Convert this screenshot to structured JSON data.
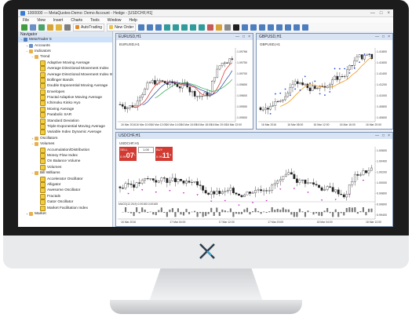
{
  "window": {
    "title": "1000000 — MetaQuotes-Demo: Demo Account - Hedge - [USDCHF,H1]",
    "controls": [
      "—",
      "□",
      "×"
    ]
  },
  "menu": [
    "File",
    "View",
    "Insert",
    "Charts",
    "Tools",
    "Window",
    "Help"
  ],
  "toolbar": {
    "autotrading_label": "AutoTrading",
    "new_order_label": "New Order"
  },
  "navigator": {
    "title": "Navigator",
    "items": [
      {
        "label": "MetaTrader 5",
        "level": 0,
        "icon": "terminal-icon",
        "expanded": true
      },
      {
        "label": "Accounts",
        "level": 1,
        "icon": "accounts-icon",
        "expanded": false
      },
      {
        "label": "Indicators",
        "level": 1,
        "icon": "folder-icon",
        "expanded": true
      },
      {
        "label": "Trend",
        "level": 2,
        "icon": "folder-icon",
        "expanded": true
      },
      {
        "label": "Adaptive Moving Average",
        "level": 3,
        "icon": "indicator-icon"
      },
      {
        "label": "Average Directional Movement Index",
        "level": 3,
        "icon": "indicator-icon"
      },
      {
        "label": "Average Directional Movement Index Wilder",
        "level": 3,
        "icon": "indicator-icon"
      },
      {
        "label": "Bollinger Bands",
        "level": 3,
        "icon": "indicator-icon"
      },
      {
        "label": "Double Exponential Moving Average",
        "level": 3,
        "icon": "indicator-icon"
      },
      {
        "label": "Envelopes",
        "level": 3,
        "icon": "indicator-icon"
      },
      {
        "label": "Fractal Adaptive Moving Average",
        "level": 3,
        "icon": "indicator-icon"
      },
      {
        "label": "Ichimoku Kinko Hyo",
        "level": 3,
        "icon": "indicator-icon"
      },
      {
        "label": "Moving Average",
        "level": 3,
        "icon": "indicator-icon"
      },
      {
        "label": "Parabolic SAR",
        "level": 3,
        "icon": "indicator-icon"
      },
      {
        "label": "Standard Deviation",
        "level": 3,
        "icon": "indicator-icon"
      },
      {
        "label": "Triple Exponential Moving Average",
        "level": 3,
        "icon": "indicator-icon"
      },
      {
        "label": "Variable Index Dynamic Average",
        "level": 3,
        "icon": "indicator-icon"
      },
      {
        "label": "Oscillators",
        "level": 2,
        "icon": "folder-icon",
        "expanded": false
      },
      {
        "label": "Volumes",
        "level": 2,
        "icon": "folder-icon",
        "expanded": true
      },
      {
        "label": "Accumulation/Distribution",
        "level": 3,
        "icon": "indicator-icon"
      },
      {
        "label": "Money Flow Index",
        "level": 3,
        "icon": "indicator-icon"
      },
      {
        "label": "On Balance Volume",
        "level": 3,
        "icon": "indicator-icon"
      },
      {
        "label": "Volumes",
        "level": 3,
        "icon": "indicator-icon"
      },
      {
        "label": "Bill Williams",
        "level": 2,
        "icon": "folder-icon",
        "expanded": true
      },
      {
        "label": "Accelerator Oscillator",
        "level": 3,
        "icon": "indicator-icon"
      },
      {
        "label": "Alligator",
        "level": 3,
        "icon": "indicator-icon"
      },
      {
        "label": "Awesome Oscillator",
        "level": 3,
        "icon": "indicator-icon"
      },
      {
        "label": "Fractals",
        "level": 3,
        "icon": "indicator-icon"
      },
      {
        "label": "Gator Oscillator",
        "level": 3,
        "icon": "indicator-icon"
      },
      {
        "label": "Market Facilitation Index",
        "level": 3,
        "icon": "indicator-icon"
      },
      {
        "label": "Market",
        "level": 1,
        "icon": "folder-icon",
        "expanded": false
      }
    ]
  },
  "charts": {
    "eurusd": {
      "window_title": "EURUSD,H1",
      "symbol_label": "EURUSD,H1",
      "prices": [
        "1.09766",
        "1.09750",
        "1.09700",
        "1.09650",
        "1.09600",
        "1.09550",
        "1.09500"
      ],
      "times": [
        "16 Mar 2016",
        "16 Mar 10:00",
        "16 Mar 12:00",
        "16 Mar 14:00",
        "16 Mar 16:00",
        "16 Mar 18:00",
        "16 Mar 20:00",
        "16 Mar 22:00"
      ]
    },
    "gbpusd": {
      "window_title": "GBPUSD,H1",
      "symbol_label": "GBPUSD,H1",
      "prices": [
        "1.41800",
        "1.41600",
        "1.41400",
        "1.41200",
        "1.41000",
        "1.40800",
        "1.40600"
      ],
      "times": [
        "16 Mar 2016",
        "16 Mar 08:00",
        "16 Mar 12:00",
        "16 Mar 16:00",
        "16 Mar 20:00"
      ]
    },
    "usdchf": {
      "window_title": "USDCHF,H1",
      "symbol_label": "USDCHF,H1",
      "oneclick": {
        "sell_label": "SELL",
        "buy_label": "BUY",
        "lot": "1.00",
        "sell_small": "0.99",
        "sell_big": "07",
        "sell_sup": "1",
        "buy_small": "0.99",
        "buy_big": "11",
        "buy_sup": "8"
      },
      "indicator_label": "MACD(12,26,9) 0.00183 0.00165",
      "prices": [
        "1.00600",
        "1.00400",
        "1.00200",
        "1.00000",
        "0.99800",
        "0.99600",
        "0.99400"
      ],
      "times": [
        "16 Mar 2016",
        "17 Mar 04:00",
        "17 Mar 12:00",
        "17 Mar 20:00",
        "18 Mar 04:00",
        "18 Mar 12:00"
      ]
    }
  },
  "device": {
    "logo_text": "X"
  },
  "colors": {
    "candle_up": "#ffffff",
    "candle_down": "#222222",
    "ma_red": "#d7261e",
    "ma_blue": "#1b3faa",
    "ma_green": "#2fa84f",
    "ma_orange": "#f08c00",
    "sar_blue": "#2a4fd8",
    "fractal_magenta": "#c026c0",
    "sell_red": "#d23a32"
  }
}
